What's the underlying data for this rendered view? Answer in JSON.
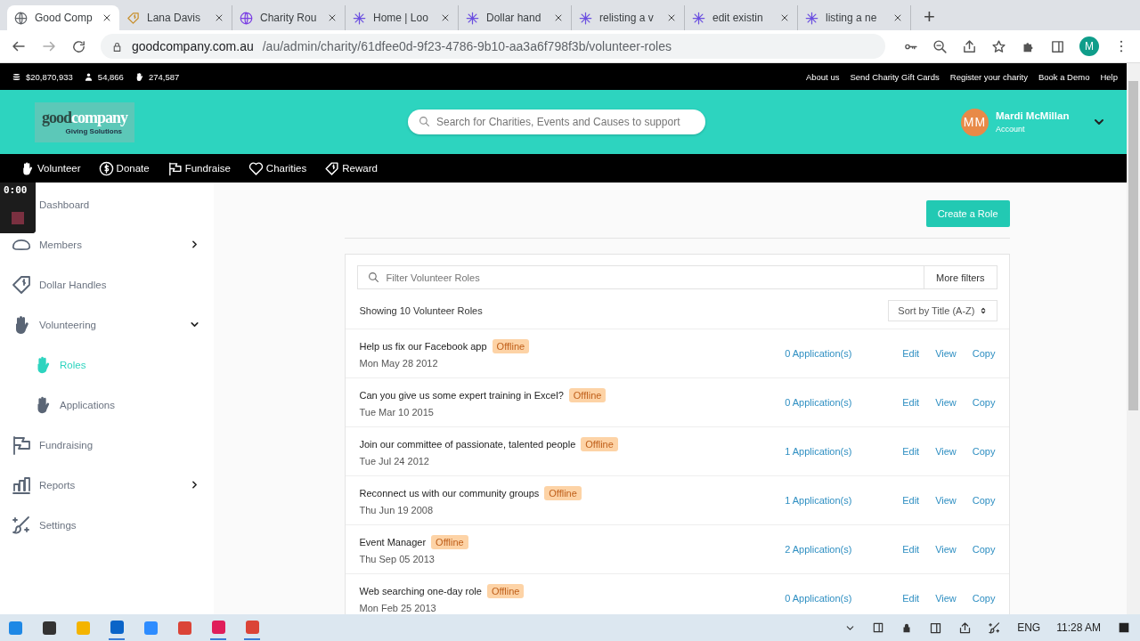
{
  "browser": {
    "tabs": [
      {
        "title": "Good Comp",
        "selected": true
      },
      {
        "title": "Lana Davis",
        "selected": false
      },
      {
        "title": "Charity Rou",
        "selected": false
      },
      {
        "title": "Home | Loo",
        "selected": false
      },
      {
        "title": "Dollar hand",
        "selected": false
      },
      {
        "title": "relisting a v",
        "selected": false
      },
      {
        "title": "edit existin",
        "selected": false
      },
      {
        "title": "listing a ne",
        "selected": false
      }
    ],
    "new_tab": "+",
    "url_host": "goodcompany.com.au",
    "url_path": "/au/admin/charity/61dfee0d-9f23-4786-9b10-aa3a6f798f3b/volunteer-roles",
    "profile": "M"
  },
  "topbar": {
    "stats": [
      "$20,870,933",
      "54,866",
      "274,587"
    ],
    "links": [
      "About us",
      "Send Charity Gift Cards",
      "Register your charity",
      "Book a Demo",
      "Help"
    ]
  },
  "header": {
    "logo": {
      "word1": "good",
      "word2": "company",
      "tagline": "Giving Solutions"
    },
    "search": {
      "placeholder": "Search for Charities, Events and Causes to support"
    },
    "user": {
      "initials": "MM",
      "name": "Mardi McMillan",
      "subtitle": "Account"
    }
  },
  "nav": [
    "Volunteer",
    "Donate",
    "Fundraise",
    "Charities",
    "Reward"
  ],
  "recorder": {
    "time": "0:00"
  },
  "sidebar": {
    "items": [
      {
        "label": "Dashboard",
        "selected": false
      },
      {
        "label": "Members",
        "selected": false,
        "expanded": false
      },
      {
        "label": "Dollar Handles",
        "selected": false
      },
      {
        "label": "Volunteering",
        "selected": false,
        "expanded": true,
        "children": [
          {
            "label": "Roles",
            "selected": true
          },
          {
            "label": "Applications",
            "selected": false
          }
        ]
      },
      {
        "label": "Fundraising",
        "selected": false
      },
      {
        "label": "Reports",
        "selected": false,
        "expanded": false
      },
      {
        "label": "Settings",
        "selected": false
      }
    ]
  },
  "main": {
    "create_button": "Create a Role",
    "filter": {
      "placeholder": "Filter Volunteer Roles"
    },
    "more_filters": "More filters",
    "showing": "Showing 10 Volunteer Roles",
    "sort": "Sort by Title (A-Z)",
    "rows": [
      {
        "title": "Help us fix our Facebook app",
        "status": "Offline",
        "date": "Mon May 28 2012",
        "applications": "0 Application(s)",
        "actions": [
          "Edit",
          "View",
          "Copy"
        ]
      },
      {
        "title": "Can you give us some expert training in Excel?",
        "status": "Offline",
        "date": "Tue Mar 10 2015",
        "applications": "0 Application(s)",
        "actions": [
          "Edit",
          "View",
          "Copy"
        ]
      },
      {
        "title": "Join our committee of passionate, talented people",
        "status": "Offline",
        "date": "Tue Jul 24 2012",
        "applications": "1 Application(s)",
        "actions": [
          "Edit",
          "View",
          "Copy"
        ]
      },
      {
        "title": "Reconnect us with our community groups",
        "status": "Offline",
        "date": "Thu Jun 19 2008",
        "applications": "1 Application(s)",
        "actions": [
          "Edit",
          "View",
          "Copy"
        ]
      },
      {
        "title": "Event Manager",
        "status": "Offline",
        "date": "Thu Sep 05 2013",
        "applications": "2 Application(s)",
        "actions": [
          "Edit",
          "View",
          "Copy"
        ]
      },
      {
        "title": "Web searching one-day role",
        "status": "Offline",
        "date": "Mon Feb 25 2013",
        "applications": "0 Application(s)",
        "actions": [
          "Edit",
          "View",
          "Copy"
        ]
      }
    ]
  },
  "taskbar": {
    "language": "ENG",
    "time": "11:28 AM"
  }
}
